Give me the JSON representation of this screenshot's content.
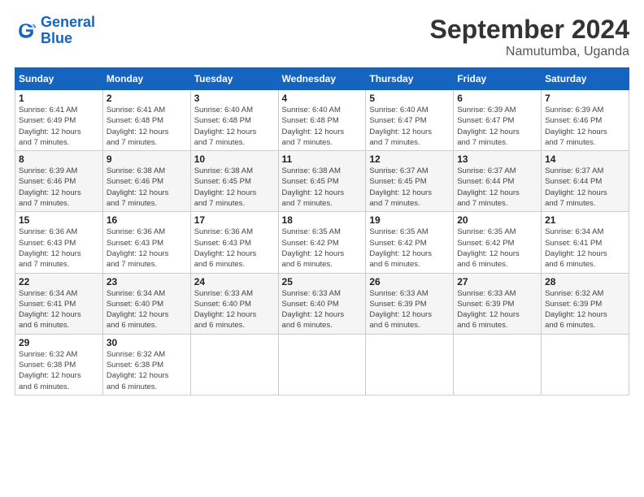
{
  "header": {
    "logo_line1": "General",
    "logo_line2": "Blue",
    "title": "September 2024",
    "subtitle": "Namutumba, Uganda"
  },
  "weekdays": [
    "Sunday",
    "Monday",
    "Tuesday",
    "Wednesday",
    "Thursday",
    "Friday",
    "Saturday"
  ],
  "weeks": [
    [
      {
        "day": "1",
        "sunrise": "6:41 AM",
        "sunset": "6:49 PM",
        "daylight": "12 hours and 7 minutes."
      },
      {
        "day": "2",
        "sunrise": "6:41 AM",
        "sunset": "6:48 PM",
        "daylight": "12 hours and 7 minutes."
      },
      {
        "day": "3",
        "sunrise": "6:40 AM",
        "sunset": "6:48 PM",
        "daylight": "12 hours and 7 minutes."
      },
      {
        "day": "4",
        "sunrise": "6:40 AM",
        "sunset": "6:48 PM",
        "daylight": "12 hours and 7 minutes."
      },
      {
        "day": "5",
        "sunrise": "6:40 AM",
        "sunset": "6:47 PM",
        "daylight": "12 hours and 7 minutes."
      },
      {
        "day": "6",
        "sunrise": "6:39 AM",
        "sunset": "6:47 PM",
        "daylight": "12 hours and 7 minutes."
      },
      {
        "day": "7",
        "sunrise": "6:39 AM",
        "sunset": "6:46 PM",
        "daylight": "12 hours and 7 minutes."
      }
    ],
    [
      {
        "day": "8",
        "sunrise": "6:39 AM",
        "sunset": "6:46 PM",
        "daylight": "12 hours and 7 minutes."
      },
      {
        "day": "9",
        "sunrise": "6:38 AM",
        "sunset": "6:46 PM",
        "daylight": "12 hours and 7 minutes."
      },
      {
        "day": "10",
        "sunrise": "6:38 AM",
        "sunset": "6:45 PM",
        "daylight": "12 hours and 7 minutes."
      },
      {
        "day": "11",
        "sunrise": "6:38 AM",
        "sunset": "6:45 PM",
        "daylight": "12 hours and 7 minutes."
      },
      {
        "day": "12",
        "sunrise": "6:37 AM",
        "sunset": "6:45 PM",
        "daylight": "12 hours and 7 minutes."
      },
      {
        "day": "13",
        "sunrise": "6:37 AM",
        "sunset": "6:44 PM",
        "daylight": "12 hours and 7 minutes."
      },
      {
        "day": "14",
        "sunrise": "6:37 AM",
        "sunset": "6:44 PM",
        "daylight": "12 hours and 7 minutes."
      }
    ],
    [
      {
        "day": "15",
        "sunrise": "6:36 AM",
        "sunset": "6:43 PM",
        "daylight": "12 hours and 7 minutes."
      },
      {
        "day": "16",
        "sunrise": "6:36 AM",
        "sunset": "6:43 PM",
        "daylight": "12 hours and 7 minutes."
      },
      {
        "day": "17",
        "sunrise": "6:36 AM",
        "sunset": "6:43 PM",
        "daylight": "12 hours and 6 minutes."
      },
      {
        "day": "18",
        "sunrise": "6:35 AM",
        "sunset": "6:42 PM",
        "daylight": "12 hours and 6 minutes."
      },
      {
        "day": "19",
        "sunrise": "6:35 AM",
        "sunset": "6:42 PM",
        "daylight": "12 hours and 6 minutes."
      },
      {
        "day": "20",
        "sunrise": "6:35 AM",
        "sunset": "6:42 PM",
        "daylight": "12 hours and 6 minutes."
      },
      {
        "day": "21",
        "sunrise": "6:34 AM",
        "sunset": "6:41 PM",
        "daylight": "12 hours and 6 minutes."
      }
    ],
    [
      {
        "day": "22",
        "sunrise": "6:34 AM",
        "sunset": "6:41 PM",
        "daylight": "12 hours and 6 minutes."
      },
      {
        "day": "23",
        "sunrise": "6:34 AM",
        "sunset": "6:40 PM",
        "daylight": "12 hours and 6 minutes."
      },
      {
        "day": "24",
        "sunrise": "6:33 AM",
        "sunset": "6:40 PM",
        "daylight": "12 hours and 6 minutes."
      },
      {
        "day": "25",
        "sunrise": "6:33 AM",
        "sunset": "6:40 PM",
        "daylight": "12 hours and 6 minutes."
      },
      {
        "day": "26",
        "sunrise": "6:33 AM",
        "sunset": "6:39 PM",
        "daylight": "12 hours and 6 minutes."
      },
      {
        "day": "27",
        "sunrise": "6:33 AM",
        "sunset": "6:39 PM",
        "daylight": "12 hours and 6 minutes."
      },
      {
        "day": "28",
        "sunrise": "6:32 AM",
        "sunset": "6:39 PM",
        "daylight": "12 hours and 6 minutes."
      }
    ],
    [
      {
        "day": "29",
        "sunrise": "6:32 AM",
        "sunset": "6:38 PM",
        "daylight": "12 hours and 6 minutes."
      },
      {
        "day": "30",
        "sunrise": "6:32 AM",
        "sunset": "6:38 PM",
        "daylight": "12 hours and 6 minutes."
      },
      null,
      null,
      null,
      null,
      null
    ]
  ]
}
